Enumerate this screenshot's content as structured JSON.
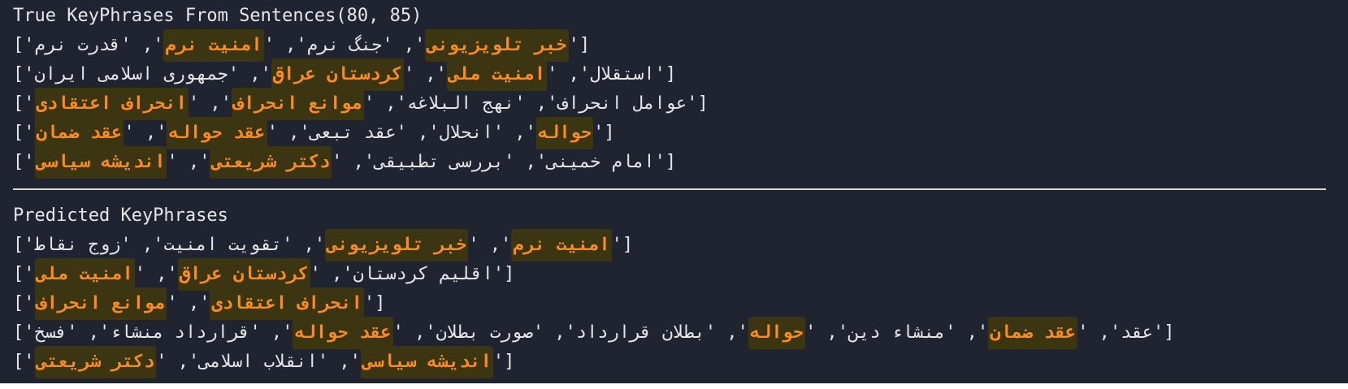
{
  "true_heading": "True KeyPhrases From Sentences(80, 85)",
  "predicted_heading": "Predicted KeyPhrases",
  "true_rows": [
    [
      {
        "text": "خبر تلویزیونی",
        "hl": true
      },
      {
        "text": "جنگ نرم",
        "hl": false
      },
      {
        "text": "امنیت نرم",
        "hl": true
      },
      {
        "text": "قدرت نرم",
        "hl": false
      }
    ],
    [
      {
        "text": "استقلال",
        "hl": false
      },
      {
        "text": "امنیت ملی",
        "hl": true
      },
      {
        "text": "کردستان عراق",
        "hl": true
      },
      {
        "text": "جمهوری اسلامی ایران",
        "hl": false
      }
    ],
    [
      {
        "text": "عوامل انحراف",
        "hl": false
      },
      {
        "text": "نهج البلاغه",
        "hl": false
      },
      {
        "text": "موانع انحراف",
        "hl": true
      },
      {
        "text": "انحراف اعتقادی",
        "hl": true
      }
    ],
    [
      {
        "text": "حواله",
        "hl": true
      },
      {
        "text": "انحلال",
        "hl": false
      },
      {
        "text": "عقد تبعی",
        "hl": false
      },
      {
        "text": "عقد حواله",
        "hl": true
      },
      {
        "text": "عقد ضمان",
        "hl": true
      }
    ],
    [
      {
        "text": "امام خمینی",
        "hl": false
      },
      {
        "text": "بررسی تطبیقی",
        "hl": false
      },
      {
        "text": "دکتر شریعتی",
        "hl": true
      },
      {
        "text": "اندیشه سیاسی",
        "hl": true
      }
    ]
  ],
  "predicted_rows": [
    [
      {
        "text": "امنیت نرم",
        "hl": true
      },
      {
        "text": "خبر تلویزیونی",
        "hl": true
      },
      {
        "text": "تقویت امنیت",
        "hl": false
      },
      {
        "text": "زوج نقاط",
        "hl": false
      }
    ],
    [
      {
        "text": "اقلیم کردستان",
        "hl": false
      },
      {
        "text": "کردستان عراق",
        "hl": true
      },
      {
        "text": "امنیت ملی",
        "hl": true
      }
    ],
    [
      {
        "text": "انحراف اعتقادی",
        "hl": true
      },
      {
        "text": "موانع انحراف",
        "hl": true
      }
    ],
    [
      {
        "text": "عقد",
        "hl": false
      },
      {
        "text": "عقد ضمان",
        "hl": true
      },
      {
        "text": "منشاء دین",
        "hl": false
      },
      {
        "text": "حواله",
        "hl": true
      },
      {
        "text": "بطلان قرارداد",
        "hl": false
      },
      {
        "text": "صورت بطلان",
        "hl": false
      },
      {
        "text": "عقد حواله",
        "hl": true
      },
      {
        "text": "قرارداد منشاء",
        "hl": false
      },
      {
        "text": "فسخ",
        "hl": false
      }
    ],
    [
      {
        "text": "اندیشه سیاسی",
        "hl": true
      },
      {
        "text": "انقلاب اسلامی",
        "hl": false
      },
      {
        "text": "دکتر شریعتی",
        "hl": true
      }
    ]
  ],
  "colors": {
    "background": "#1f2430",
    "text": "#e6e6e6",
    "highlight_text": "#ff8c1a",
    "highlight_bg": "#3b3512"
  }
}
